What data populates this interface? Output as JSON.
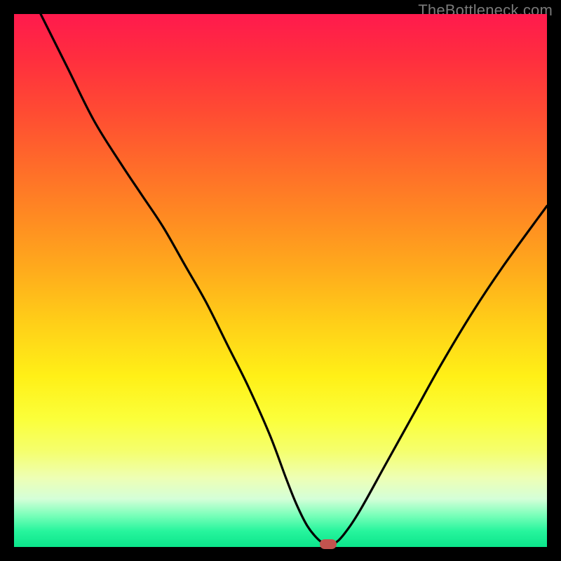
{
  "watermark": "TheBottleneck.com",
  "chart_data": {
    "type": "line",
    "title": "",
    "xlabel": "",
    "ylabel": "",
    "xlim": [
      0,
      100
    ],
    "ylim": [
      0,
      100
    ],
    "series": [
      {
        "name": "curve",
        "x": [
          5,
          10,
          15,
          20,
          24,
          28,
          32,
          36,
          40,
          44,
          48,
          51,
          53,
          55,
          57,
          58.5,
          60,
          62,
          65,
          70,
          75,
          80,
          86,
          92,
          100
        ],
        "y": [
          100,
          90,
          80,
          72,
          66,
          60,
          53,
          46,
          38,
          30,
          21,
          13,
          8,
          4,
          1.5,
          0.6,
          0.6,
          2.5,
          7,
          16,
          25,
          34,
          44,
          53,
          64
        ]
      }
    ],
    "marker": {
      "x": 59,
      "y": 0.5
    },
    "background_gradient": {
      "top": "#ff1a4d",
      "mid": "#ffd21a",
      "bottom": "#0be58b"
    }
  }
}
